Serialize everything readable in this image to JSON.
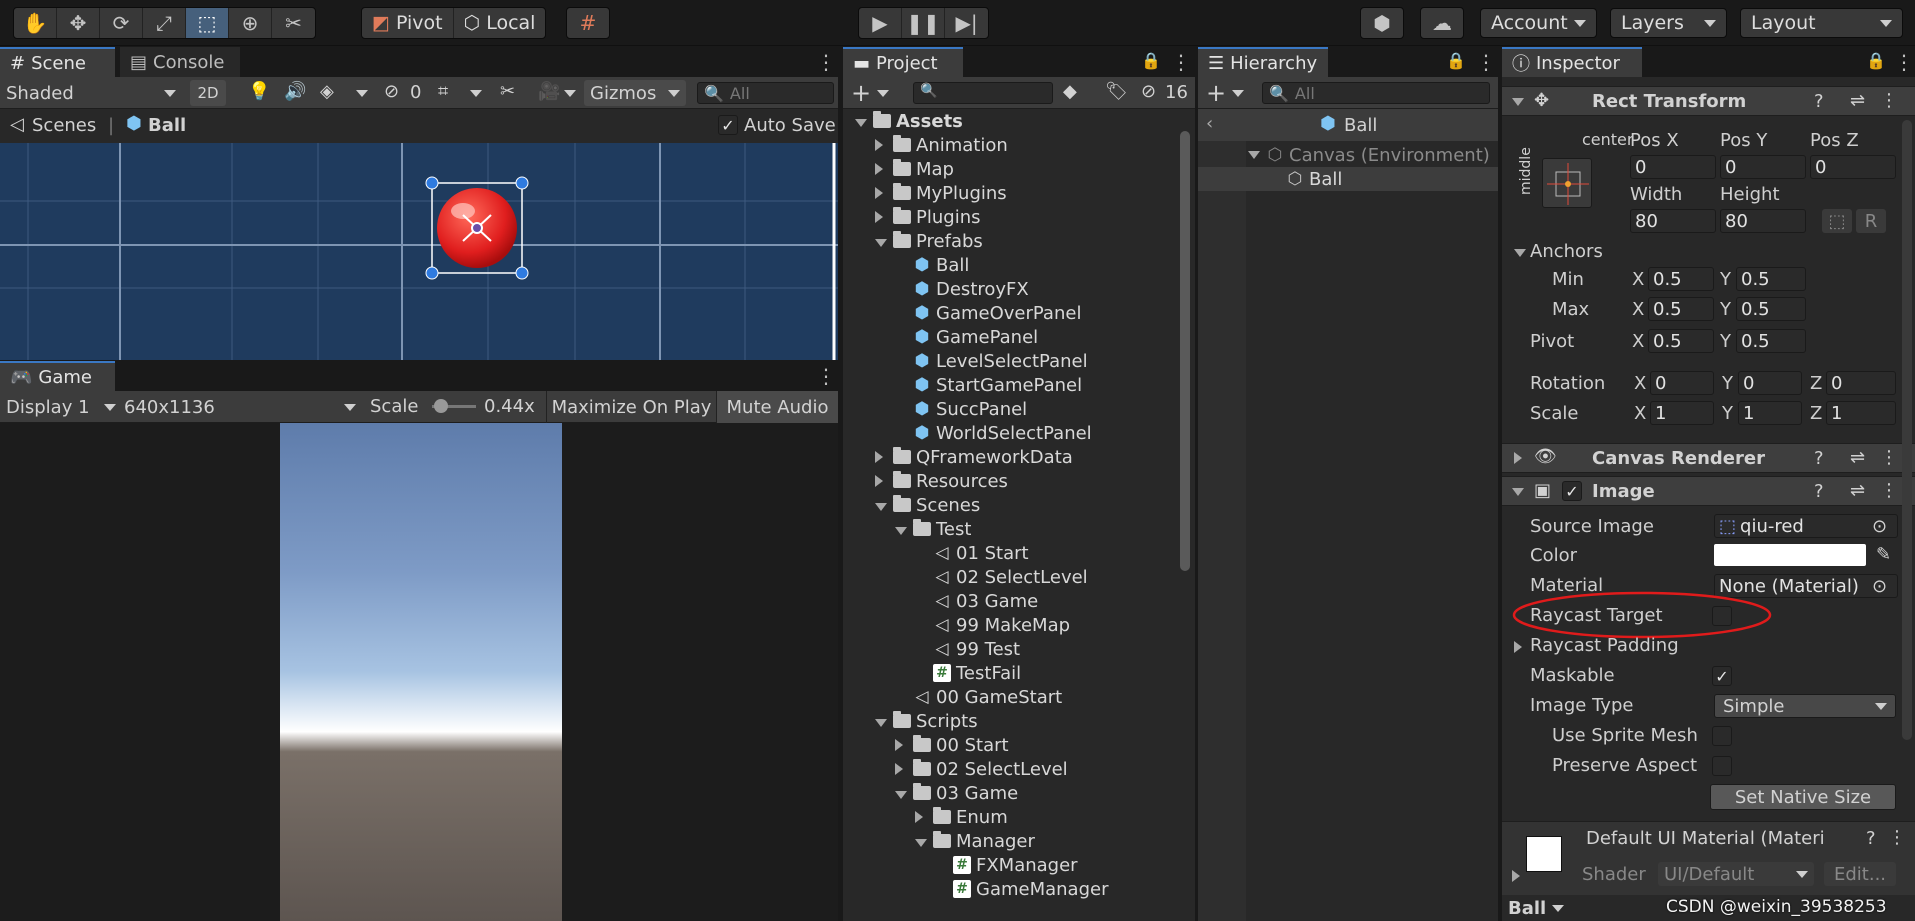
{
  "toolbar": {
    "tools": [
      "hand-icon",
      "move-icon",
      "rotate-icon",
      "scale-icon",
      "rect-tool-icon",
      "transform-icon",
      "custom-tool-icon"
    ],
    "pivot_label": "Pivot",
    "local_label": "Local",
    "account_label": "Account",
    "layers_label": "Layers",
    "layout_label": "Layout"
  },
  "scene_panel": {
    "tab_scene": "Scene",
    "tab_console": "Console",
    "shading": "Shaded",
    "mode_2d": "2D",
    "hidden_count": "0",
    "gizmos": "Gizmos",
    "search_placeholder": "All",
    "breadcrumb_root": "Scenes",
    "breadcrumb_sep": "|",
    "breadcrumb_current": "Ball",
    "auto_save": "Auto Save"
  },
  "game_panel": {
    "tab": "Game",
    "display": "Display 1",
    "resolution": "640x1136",
    "scale_label": "Scale",
    "scale_value": "0.44x",
    "scale_fraction": 0.08,
    "maximize": "Maximize On Play",
    "mute": "Mute Audio"
  },
  "project_panel": {
    "tab": "Project",
    "hidden_count": "16",
    "tree": [
      {
        "label": "Assets",
        "depth": 0,
        "kind": "folder-open",
        "bold": true
      },
      {
        "label": "Animation",
        "depth": 1,
        "kind": "folder"
      },
      {
        "label": "Map",
        "depth": 1,
        "kind": "folder"
      },
      {
        "label": "MyPlugins",
        "depth": 1,
        "kind": "folder"
      },
      {
        "label": "Plugins",
        "depth": 1,
        "kind": "folder"
      },
      {
        "label": "Prefabs",
        "depth": 1,
        "kind": "folder-open"
      },
      {
        "label": "Ball",
        "depth": 2,
        "kind": "prefab"
      },
      {
        "label": "DestroyFX",
        "depth": 2,
        "kind": "prefab"
      },
      {
        "label": "GameOverPanel",
        "depth": 2,
        "kind": "prefab"
      },
      {
        "label": "GamePanel",
        "depth": 2,
        "kind": "prefab"
      },
      {
        "label": "LevelSelectPanel",
        "depth": 2,
        "kind": "prefab"
      },
      {
        "label": "StartGamePanel",
        "depth": 2,
        "kind": "prefab"
      },
      {
        "label": "SuccPanel",
        "depth": 2,
        "kind": "prefab"
      },
      {
        "label": "WorldSelectPanel",
        "depth": 2,
        "kind": "prefab"
      },
      {
        "label": "QFrameworkData",
        "depth": 1,
        "kind": "folder"
      },
      {
        "label": "Resources",
        "depth": 1,
        "kind": "folder"
      },
      {
        "label": "Scenes",
        "depth": 1,
        "kind": "folder-open"
      },
      {
        "label": "Test",
        "depth": 2,
        "kind": "folder-open"
      },
      {
        "label": "01 Start",
        "depth": 3,
        "kind": "scene"
      },
      {
        "label": "02 SelectLevel",
        "depth": 3,
        "kind": "scene"
      },
      {
        "label": "03 Game",
        "depth": 3,
        "kind": "scene"
      },
      {
        "label": "99 MakeMap",
        "depth": 3,
        "kind": "scene"
      },
      {
        "label": "99 Test",
        "depth": 3,
        "kind": "scene"
      },
      {
        "label": "TestFail",
        "depth": 3,
        "kind": "script"
      },
      {
        "label": "00 GameStart",
        "depth": 2,
        "kind": "scene"
      },
      {
        "label": "Scripts",
        "depth": 1,
        "kind": "folder-open"
      },
      {
        "label": "00 Start",
        "depth": 2,
        "kind": "folder"
      },
      {
        "label": "02 SelectLevel",
        "depth": 2,
        "kind": "folder"
      },
      {
        "label": "03 Game",
        "depth": 2,
        "kind": "folder-open"
      },
      {
        "label": "Enum",
        "depth": 3,
        "kind": "folder"
      },
      {
        "label": "Manager",
        "depth": 3,
        "kind": "folder-open"
      },
      {
        "label": "FXManager",
        "depth": 4,
        "kind": "script"
      },
      {
        "label": "GameManager",
        "depth": 4,
        "kind": "script"
      }
    ]
  },
  "hierarchy_panel": {
    "tab": "Hierarchy",
    "search_placeholder": "All",
    "prefab_title": "Ball",
    "canvas": "Canvas (Environment)",
    "child": "Ball"
  },
  "inspector": {
    "tab": "Inspector",
    "rect_transform": "Rect Transform",
    "anchor_h": "center",
    "anchor_v": "middle",
    "pos_x_label": "Pos X",
    "pos_y_label": "Pos Y",
    "pos_z_label": "Pos Z",
    "pos_x": "0",
    "pos_y": "0",
    "pos_z": "0",
    "width_label": "Width",
    "height_label": "Height",
    "width": "80",
    "height": "80",
    "r_button": "R",
    "anchors": "Anchors",
    "min_label": "Min",
    "max_label": "Max",
    "pivot_label": "Pivot",
    "x": "X",
    "y": "Y",
    "z": "Z",
    "min_x": "0.5",
    "min_y": "0.5",
    "max_x": "0.5",
    "max_y": "0.5",
    "pivot_x": "0.5",
    "pivot_y": "0.5",
    "rotation_label": "Rotation",
    "rot_x": "0",
    "rot_y": "0",
    "rot_z": "0",
    "scale_label": "Scale",
    "scale_x": "1",
    "scale_y": "1",
    "scale_z": "1",
    "canvas_renderer": "Canvas Renderer",
    "image": "Image",
    "source_image_label": "Source Image",
    "source_image": "qiu-red",
    "color_label": "Color",
    "color_value": "#ffffff",
    "material_label": "Material",
    "material": "None (Material)",
    "raycast_target_label": "Raycast Target",
    "raycast_padding_label": "Raycast Padding",
    "maskable_label": "Maskable",
    "image_type_label": "Image Type",
    "image_type": "Simple",
    "use_sprite_mesh_label": "Use Sprite Mesh",
    "preserve_aspect_label": "Preserve Aspect",
    "set_native_size": "Set Native Size",
    "default_material": "Default UI Material (Materi",
    "shader_label": "Shader",
    "shader": "UI/Default",
    "edit": "Edit...",
    "footer_object": "Ball",
    "watermark": "CSDN @weixin_39538253"
  },
  "colors": {
    "accent": "#3a78c4",
    "annotation": "#e01b1b",
    "scene_bg": "#1f3b5e"
  }
}
